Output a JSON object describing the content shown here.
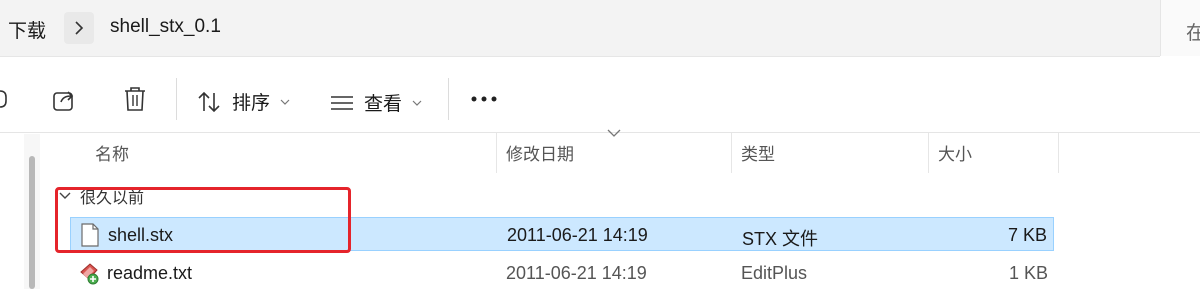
{
  "address": {
    "crumbs": [
      "下载",
      "shell_stx_0.1"
    ],
    "search_partial": "在"
  },
  "toolbar": {
    "sort_label": "排序",
    "view_label": "查看"
  },
  "columns": {
    "name": "名称",
    "modified": "修改日期",
    "type": "类型",
    "size": "大小"
  },
  "group": {
    "label": "很久以前"
  },
  "files": [
    {
      "name": "shell.stx",
      "modified": "2011-06-21 14:19",
      "type": "STX 文件",
      "size": "7 KB",
      "selected": true,
      "icon": "generic-file-icon"
    },
    {
      "name": "readme.txt",
      "modified": "2011-06-21 14:19",
      "type": "EditPlus",
      "size": "1 KB",
      "selected": false,
      "icon": "editplus-file-icon"
    }
  ],
  "colors": {
    "selection": "#cce8ff",
    "selection_border": "#99d1ff",
    "annotation": "#e5242b"
  }
}
